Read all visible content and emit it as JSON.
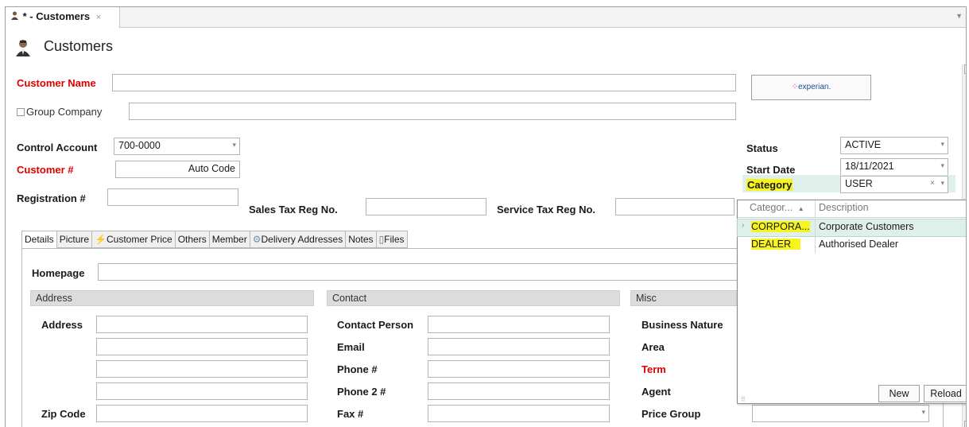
{
  "tab": {
    "title": "* - Customers",
    "close": "×"
  },
  "header": {
    "title": "Customers"
  },
  "form": {
    "customer_name_label": "Customer Name",
    "group_company_label": "Group Company",
    "control_account_label": "Control Account",
    "control_account_value": "700-0000",
    "customer_no_label": "Customer #",
    "customer_no_value": "Auto Code",
    "registration_label": "Registration #",
    "sales_tax_label": "Sales Tax Reg No.",
    "service_tax_label": "Service Tax Reg No."
  },
  "experian": {
    "label": "experian."
  },
  "status_panel": {
    "status_label": "Status",
    "status_value": "ACTIVE",
    "start_date_label": "Start Date",
    "start_date_value": "18/11/2021",
    "category_label": "Category",
    "category_value": "USER",
    "clear_glyph": "×"
  },
  "subtabs": [
    "Details",
    "Picture",
    "Customer Price",
    "Others",
    "Member",
    "Delivery Addresses",
    "Notes",
    "Files"
  ],
  "details": {
    "homepage_label": "Homepage",
    "address_group": "Address",
    "address_label": "Address",
    "zip_label": "Zip Code",
    "contact_group": "Contact",
    "contact_person_label": "Contact Person",
    "email_label": "Email",
    "phone_label": "Phone #",
    "phone2_label": "Phone 2 #",
    "fax_label": "Fax #",
    "misc_group": "Misc",
    "business_nature_label": "Business Nature",
    "area_label": "Area",
    "term_label": "Term",
    "agent_label": "Agent",
    "price_group_label": "Price Group"
  },
  "category_popup": {
    "columns": [
      "Categor...",
      "Description"
    ],
    "sort_glyph": "▲",
    "rows": [
      {
        "code": "CORPORA...",
        "description": "Corporate Customers"
      },
      {
        "code": "DEALER",
        "description": "Authorised Dealer"
      }
    ],
    "row_marker": "›",
    "new_button": "New",
    "reload_button": "Reload"
  },
  "colors": {
    "required_label": "#e00000",
    "highlight": "#f7f41e",
    "selected_row": "#dff0ea"
  }
}
